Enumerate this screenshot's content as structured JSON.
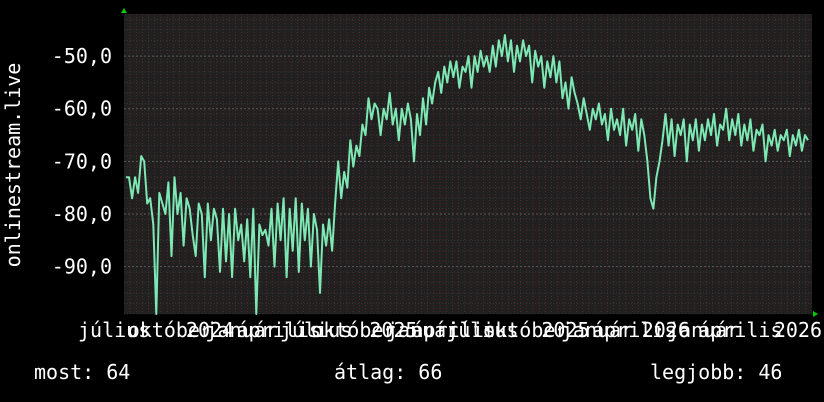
{
  "colors": {
    "background": "#000000",
    "plot_background": "#202020",
    "grid_major": "#404040",
    "grid_minor": "#e03030",
    "series": "#7ee8b4",
    "text": "#ffffff",
    "axis_arrow": "#00cc00"
  },
  "stats": {
    "current": "most: 64",
    "average": "átlag: 66",
    "best": "legjobb: 46"
  },
  "chart_data": {
    "type": "line",
    "ylabel": "onlinestream.live",
    "ylim": [
      -99,
      -42
    ],
    "yticks": [
      -90,
      -80,
      -70,
      -60,
      -50
    ],
    "ytick_labels": [
      "-90,0",
      "-80,0",
      "-70,0",
      "-60,0",
      "-50,0"
    ],
    "xlim": [
      0,
      24
    ],
    "xticks": [
      0,
      3,
      6,
      9,
      12,
      15,
      18,
      21,
      24
    ],
    "xtick_labels": [
      "július",
      "október",
      "2024",
      "január",
      "április",
      "július",
      "október",
      "2025",
      "január",
      "április",
      "július",
      "október",
      "2025",
      "január",
      "április",
      "2026",
      "január",
      "április",
      "2026"
    ],
    "xtick_label_positions": [
      0.3,
      1.6,
      3.0,
      4.1,
      5.4,
      6.7,
      8.0,
      9.4,
      10.4,
      11.5,
      12.5,
      14.0,
      15.4,
      16.5,
      17.8,
      18.9,
      20.2,
      21.5,
      23.6
    ],
    "grid": true,
    "series": [
      {
        "values": [
          -73,
          -73,
          -77,
          -73,
          -76,
          -69,
          -70,
          -78,
          -77,
          -82,
          -99,
          -76,
          -78,
          -80,
          -74,
          -88,
          -73,
          -80,
          -76,
          -86,
          -77,
          -79,
          -84,
          -88,
          -78,
          -80,
          -92,
          -78,
          -85,
          -79,
          -81,
          -91,
          -79,
          -89,
          -80,
          -92,
          -79,
          -85,
          -82,
          -89,
          -81,
          -92,
          -79,
          -99,
          -82,
          -84,
          -83,
          -86,
          -79,
          -90,
          -78,
          -85,
          -77,
          -92,
          -79,
          -87,
          -77,
          -91,
          -78,
          -85,
          -79,
          -90,
          -80,
          -83,
          -95,
          -82,
          -86,
          -81,
          -87,
          -78,
          -70,
          -77,
          -72,
          -75,
          -66,
          -71,
          -67,
          -69,
          -63,
          -65,
          -58,
          -62,
          -59,
          -60,
          -65,
          -60,
          -62,
          -57,
          -63,
          -60,
          -66,
          -60,
          -63,
          -59,
          -62,
          -70,
          -61,
          -65,
          -58,
          -63,
          -56,
          -59,
          -55,
          -53,
          -57,
          -52,
          -55,
          -51,
          -54,
          -51,
          -56,
          -52,
          -53,
          -50,
          -56,
          -50,
          -53,
          -49,
          -52,
          -50,
          -53,
          -48,
          -52,
          -47,
          -50,
          -46,
          -51,
          -47,
          -53,
          -48,
          -51,
          -47,
          -50,
          -48,
          -55,
          -49,
          -52,
          -50,
          -56,
          -51,
          -54,
          -50,
          -55,
          -51,
          -58,
          -55,
          -60,
          -54,
          -57,
          -59,
          -62,
          -58,
          -61,
          -64,
          -60,
          -62,
          -59,
          -63,
          -61,
          -66,
          -60,
          -64,
          -62,
          -65,
          -60,
          -67,
          -62,
          -64,
          -61,
          -68,
          -62,
          -65,
          -70,
          -77,
          -79,
          -73,
          -70,
          -66,
          -61,
          -67,
          -62,
          -69,
          -63,
          -65,
          -62,
          -70,
          -63,
          -66,
          -62,
          -68,
          -63,
          -66,
          -62,
          -65,
          -61,
          -67,
          -63,
          -64,
          -60,
          -66,
          -62,
          -65,
          -61,
          -67,
          -63,
          -66,
          -62,
          -68,
          -64,
          -65,
          -63,
          -70,
          -65,
          -67,
          -64,
          -68,
          -65,
          -66,
          -64,
          -69,
          -65,
          -67,
          -64,
          -68,
          -65,
          -66
        ]
      }
    ]
  }
}
